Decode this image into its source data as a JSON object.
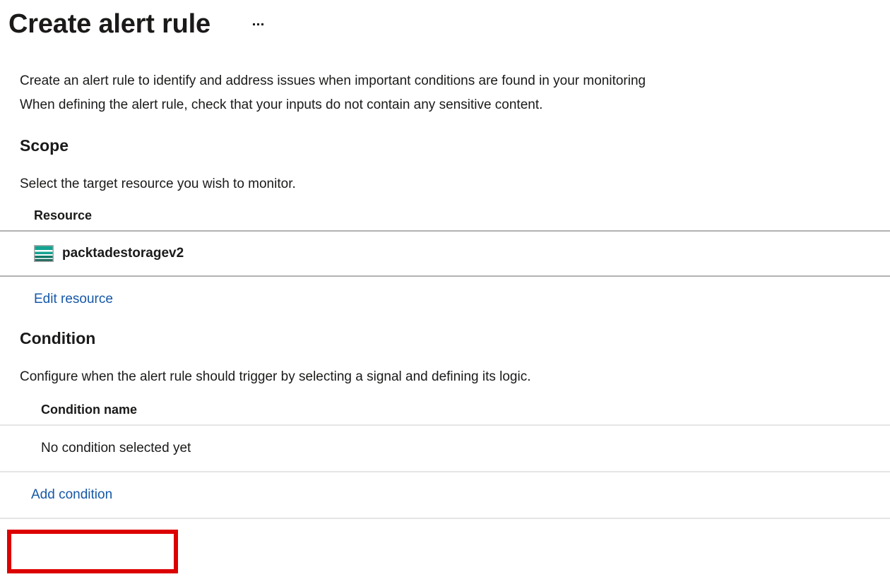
{
  "header": {
    "title": "Create alert rule",
    "more_icon": "ellipsis-icon"
  },
  "intro": {
    "line1": "Create an alert rule to identify and address issues when important conditions are found in your monitoring",
    "line2": "When defining the alert rule, check that your inputs do not contain any sensitive content."
  },
  "scope": {
    "heading": "Scope",
    "description": "Select the target resource you wish to monitor.",
    "table": {
      "columns": [
        "Resource"
      ],
      "rows": [
        {
          "icon": "storage-account-icon",
          "name": "packtadestoragev2"
        }
      ]
    },
    "edit_resource_label": "Edit resource"
  },
  "condition": {
    "heading": "Condition",
    "description": "Configure when the alert rule should trigger by selecting a signal and defining its logic.",
    "table": {
      "columns": [
        "Condition name"
      ],
      "rows": [
        {
          "name": "No condition selected yet"
        }
      ]
    },
    "add_condition_label": "Add condition"
  },
  "colors": {
    "link": "#1558a8",
    "text": "#1b1a19",
    "rule_dark": "#b3b3b3",
    "rule_light": "#e5e5e5",
    "annotation": "#dc0000",
    "storage_icon_teal": "#13a391",
    "storage_icon_dark": "#12806f"
  }
}
